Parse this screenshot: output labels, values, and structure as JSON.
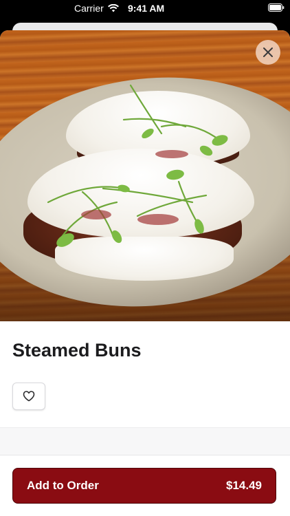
{
  "status_bar": {
    "carrier": "Carrier",
    "time": "9:41 AM",
    "wifi_icon": "wifi-icon",
    "battery_icon": "battery-icon"
  },
  "item": {
    "name": "Steamed Buns",
    "image_alt_icon": "food-photo",
    "close_icon": "close-icon",
    "favorite_icon": "heart-icon"
  },
  "order": {
    "button_label": "Add to Order",
    "price": "$14.49"
  },
  "colors": {
    "accent": "#8a0c12",
    "accent_border": "#4d0508",
    "text_primary": "#1c1c1e"
  }
}
